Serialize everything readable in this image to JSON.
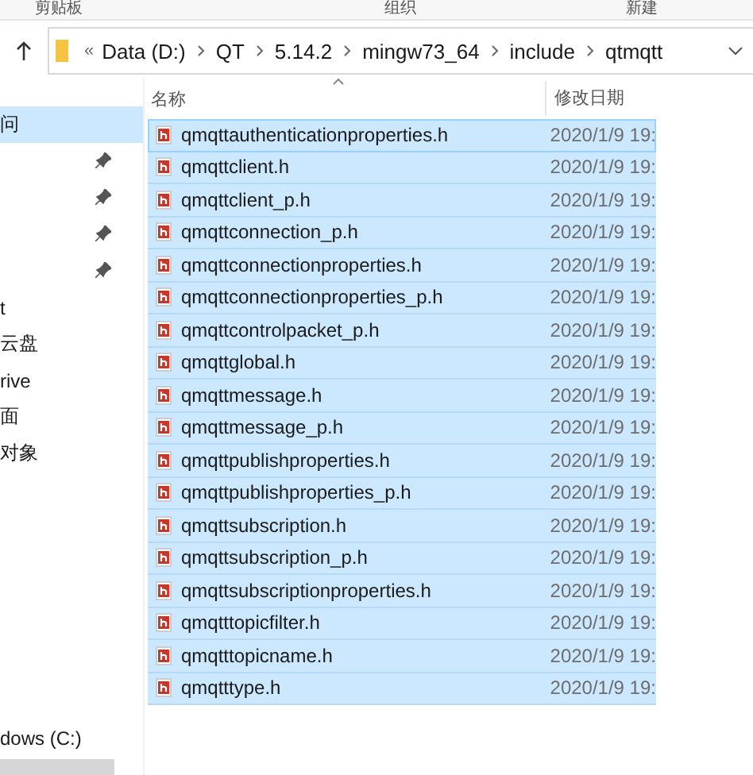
{
  "ribbon": {
    "groups": [
      "剪贴板",
      "组织",
      "新建"
    ]
  },
  "address_bar": {
    "overflow": "«",
    "crumbs": [
      "Data (D:)",
      "QT",
      "5.14.2",
      "mingw73_64",
      "include",
      "qtmqtt"
    ]
  },
  "sidebar": {
    "items": [
      {
        "label": "问",
        "pinned": false,
        "selected": true
      },
      {
        "pinned": true,
        "selected": false
      },
      {
        "pinned": true,
        "selected": false
      },
      {
        "pinned": true,
        "selected": false
      },
      {
        "pinned": true,
        "selected": false
      },
      {
        "label": "t",
        "pinned": false,
        "selected": false
      },
      {
        "label": "云盘",
        "pinned": false,
        "selected": false
      },
      {
        "label": "rive",
        "pinned": false,
        "selected": false
      },
      {
        "label": "面",
        "pinned": false,
        "selected": false
      },
      {
        "label": "对象",
        "pinned": false,
        "selected": false
      }
    ],
    "bottom_item": {
      "label": "dows (C:)"
    }
  },
  "table": {
    "columns": [
      "名称",
      "修改日期"
    ],
    "rows": [
      {
        "name": "qmqttauthenticationproperties.h",
        "date": "2020/1/9 19:",
        "selected": true
      },
      {
        "name": "qmqttclient.h",
        "date": "2020/1/9 19:",
        "selected": true
      },
      {
        "name": "qmqttclient_p.h",
        "date": "2020/1/9 19:",
        "selected": true
      },
      {
        "name": "qmqttconnection_p.h",
        "date": "2020/1/9 19:",
        "selected": true
      },
      {
        "name": "qmqttconnectionproperties.h",
        "date": "2020/1/9 19:",
        "selected": true
      },
      {
        "name": "qmqttconnectionproperties_p.h",
        "date": "2020/1/9 19:",
        "selected": true
      },
      {
        "name": "qmqttcontrolpacket_p.h",
        "date": "2020/1/9 19:",
        "selected": true
      },
      {
        "name": "qmqttglobal.h",
        "date": "2020/1/9 19:",
        "selected": true
      },
      {
        "name": "qmqttmessage.h",
        "date": "2020/1/9 19:",
        "selected": true
      },
      {
        "name": "qmqttmessage_p.h",
        "date": "2020/1/9 19:",
        "selected": true
      },
      {
        "name": "qmqttpublishproperties.h",
        "date": "2020/1/9 19:",
        "selected": true
      },
      {
        "name": "qmqttpublishproperties_p.h",
        "date": "2020/1/9 19:",
        "selected": true
      },
      {
        "name": "qmqttsubscription.h",
        "date": "2020/1/9 19:",
        "selected": true
      },
      {
        "name": "qmqttsubscription_p.h",
        "date": "2020/1/9 19:",
        "selected": true
      },
      {
        "name": "qmqttsubscriptionproperties.h",
        "date": "2020/1/9 19:",
        "selected": true
      },
      {
        "name": "qmqtttopicfilter.h",
        "date": "2020/1/9 19:",
        "selected": true
      },
      {
        "name": "qmqtttopicname.h",
        "date": "2020/1/9 19:",
        "selected": true
      },
      {
        "name": "qmqtttype.h",
        "date": "2020/1/9 19:",
        "selected": true
      }
    ]
  }
}
